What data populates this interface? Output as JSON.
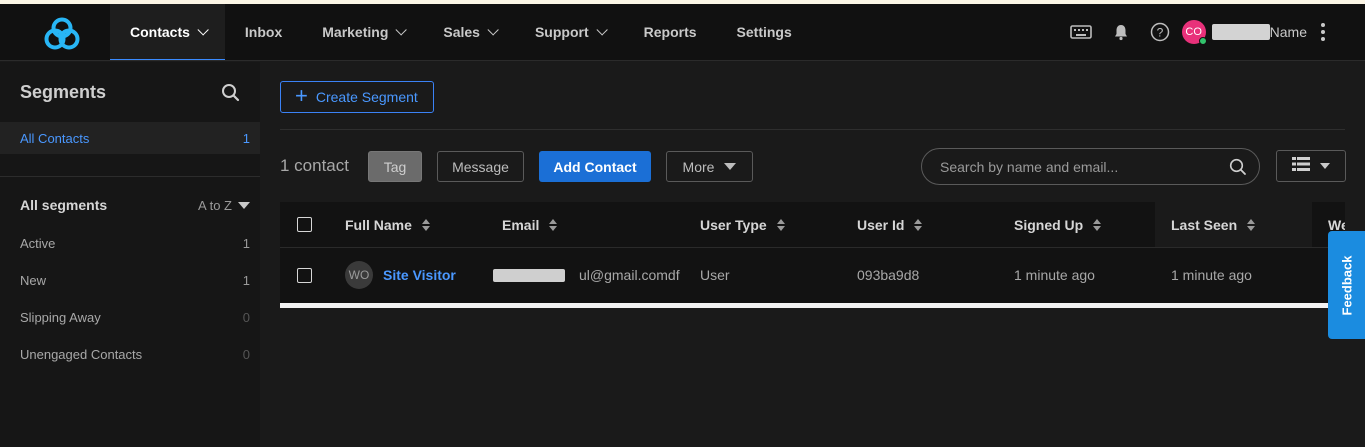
{
  "nav": {
    "items": [
      {
        "label": "Contacts",
        "active": true,
        "dropdown": true
      },
      {
        "label": "Inbox",
        "active": false,
        "dropdown": false
      },
      {
        "label": "Marketing",
        "active": false,
        "dropdown": true
      },
      {
        "label": "Sales",
        "active": false,
        "dropdown": true
      },
      {
        "label": "Support",
        "active": false,
        "dropdown": true
      },
      {
        "label": "Reports",
        "active": false,
        "dropdown": false
      },
      {
        "label": "Settings",
        "active": false,
        "dropdown": false
      }
    ],
    "icons": [
      "keyboard-icon",
      "bell-icon",
      "help-icon"
    ],
    "user": {
      "initials": "CO",
      "name": "Name",
      "avatar_color": "#e8317a",
      "status_color": "#32c36c"
    }
  },
  "sidebar": {
    "title": "Segments",
    "all_contacts": {
      "label": "All Contacts",
      "count": "1"
    },
    "segments_header": "All segments",
    "sort_label": "A to Z",
    "segments": [
      {
        "label": "Active",
        "count": "1"
      },
      {
        "label": "New",
        "count": "1"
      },
      {
        "label": "Slipping Away",
        "count": "0"
      },
      {
        "label": "Unengaged Contacts",
        "count": "0"
      }
    ]
  },
  "main": {
    "create_segment": "Create Segment",
    "contact_count": "1 contact",
    "tag_label": "Tag",
    "message_label": "Message",
    "add_contact_label": "Add Contact",
    "more_label": "More",
    "search_placeholder": "Search by name and email...",
    "table": {
      "headers": [
        "Full Name",
        "Email",
        "User Type",
        "User Id",
        "Signed Up",
        "Last Seen",
        "We"
      ],
      "rows": [
        {
          "initials": "WO",
          "name": "Site Visitor",
          "email": "ul@gmail.comdf",
          "user_type": "User",
          "user_id": "093ba9d8",
          "signed_up": "1 minute ago",
          "last_seen": "1 minute ago"
        }
      ]
    }
  },
  "feedback_label": "Feedback",
  "colors": {
    "accent": "#1b6fd6",
    "link": "#4a98ff",
    "feedback": "#1b8ce0",
    "logo": "#28b6f6"
  }
}
